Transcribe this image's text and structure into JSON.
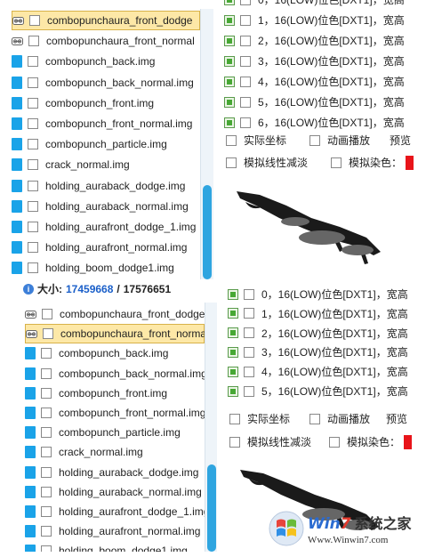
{
  "top": {
    "files": [
      {
        "name": "combopunchaura_front_dodge",
        "icon": "link-icon",
        "selected": true
      },
      {
        "name": "combopunchaura_front_normal",
        "icon": "link-icon",
        "selected": false
      },
      {
        "name": "combopunch_back.img",
        "icon": "file-icon",
        "selected": false
      },
      {
        "name": "combopunch_back_normal.img",
        "icon": "file-icon",
        "selected": false
      },
      {
        "name": "combopunch_front.img",
        "icon": "file-icon",
        "selected": false
      },
      {
        "name": "combopunch_front_normal.img",
        "icon": "file-icon",
        "selected": false
      },
      {
        "name": "combopunch_particle.img",
        "icon": "file-icon",
        "selected": false
      },
      {
        "name": "crack_normal.img",
        "icon": "file-icon",
        "selected": false
      },
      {
        "name": "holding_auraback_dodge.img",
        "icon": "file-icon",
        "selected": false
      },
      {
        "name": "holding_auraback_normal.img",
        "icon": "file-icon",
        "selected": false
      },
      {
        "name": "holding_aurafront_dodge_1.img",
        "icon": "file-icon",
        "selected": false
      },
      {
        "name": "holding_aurafront_normal.img",
        "icon": "file-icon",
        "selected": false
      },
      {
        "name": "holding_boom_dodge1.img",
        "icon": "file-icon",
        "selected": false
      }
    ],
    "frames": [
      "0，16(LOW)位色[DXT1]，宽高",
      "1，16(LOW)位色[DXT1]，宽高",
      "2，16(LOW)位色[DXT1]，宽高",
      "3，16(LOW)位色[DXT1]，宽高",
      "4，16(LOW)位色[DXT1]，宽高",
      "5，16(LOW)位色[DXT1]，宽高",
      "6，16(LOW)位色[DXT1]，宽高"
    ],
    "options": {
      "actual_coords": "实际坐标",
      "anim_play": "动画播放",
      "preview": "预览",
      "linear_fade": "模拟线性减淡",
      "dye": "模拟染色："
    }
  },
  "info_bar": {
    "label": "大小:",
    "value1": "17459668",
    "sep": "/",
    "value2": "17576651"
  },
  "bottom": {
    "files": [
      {
        "name": "combopunchaura_front_dodge",
        "icon": "link-icon",
        "selected": false
      },
      {
        "name": "combopunchaura_front_normal",
        "icon": "link-icon",
        "selected": true
      },
      {
        "name": "combopunch_back.img",
        "icon": "file-icon",
        "selected": false
      },
      {
        "name": "combopunch_back_normal.img",
        "icon": "file-icon",
        "selected": false
      },
      {
        "name": "combopunch_front.img",
        "icon": "file-icon",
        "selected": false
      },
      {
        "name": "combopunch_front_normal.img",
        "icon": "file-icon",
        "selected": false
      },
      {
        "name": "combopunch_particle.img",
        "icon": "file-icon",
        "selected": false
      },
      {
        "name": "crack_normal.img",
        "icon": "file-icon",
        "selected": false
      },
      {
        "name": "holding_auraback_dodge.img",
        "icon": "file-icon",
        "selected": false
      },
      {
        "name": "holding_auraback_normal.img",
        "icon": "file-icon",
        "selected": false
      },
      {
        "name": "holding_aurafront_dodge_1.img",
        "icon": "file-icon",
        "selected": false
      },
      {
        "name": "holding_aurafront_normal.img",
        "icon": "file-icon",
        "selected": false
      },
      {
        "name": "holding_boom_dodge1.img",
        "icon": "file-icon",
        "selected": false
      }
    ],
    "frames": [
      "0，16(LOW)位色[DXT1]，宽高",
      "1，16(LOW)位色[DXT1]，宽高",
      "2，16(LOW)位色[DXT1]，宽高",
      "3，16(LOW)位色[DXT1]，宽高",
      "4，16(LOW)位色[DXT1]，宽高",
      "5，16(LOW)位色[DXT1]，宽高"
    ],
    "options": {
      "actual_coords": "实际坐标",
      "anim_play": "动画播放",
      "preview": "预览",
      "linear_fade": "模拟线性减淡",
      "dye": "模拟染色："
    }
  },
  "watermark": {
    "win": "Win",
    "seven": "7",
    "site_cn": "系统之家",
    "url": "Www.Winwin7.com"
  },
  "colors": {
    "file_icon": "#1aa3e8",
    "selection": "#fde8a7",
    "scroll_thumb": "#2fa5e0",
    "dye_swatch": "#e8141a",
    "info_value": "#1a5fc9"
  }
}
